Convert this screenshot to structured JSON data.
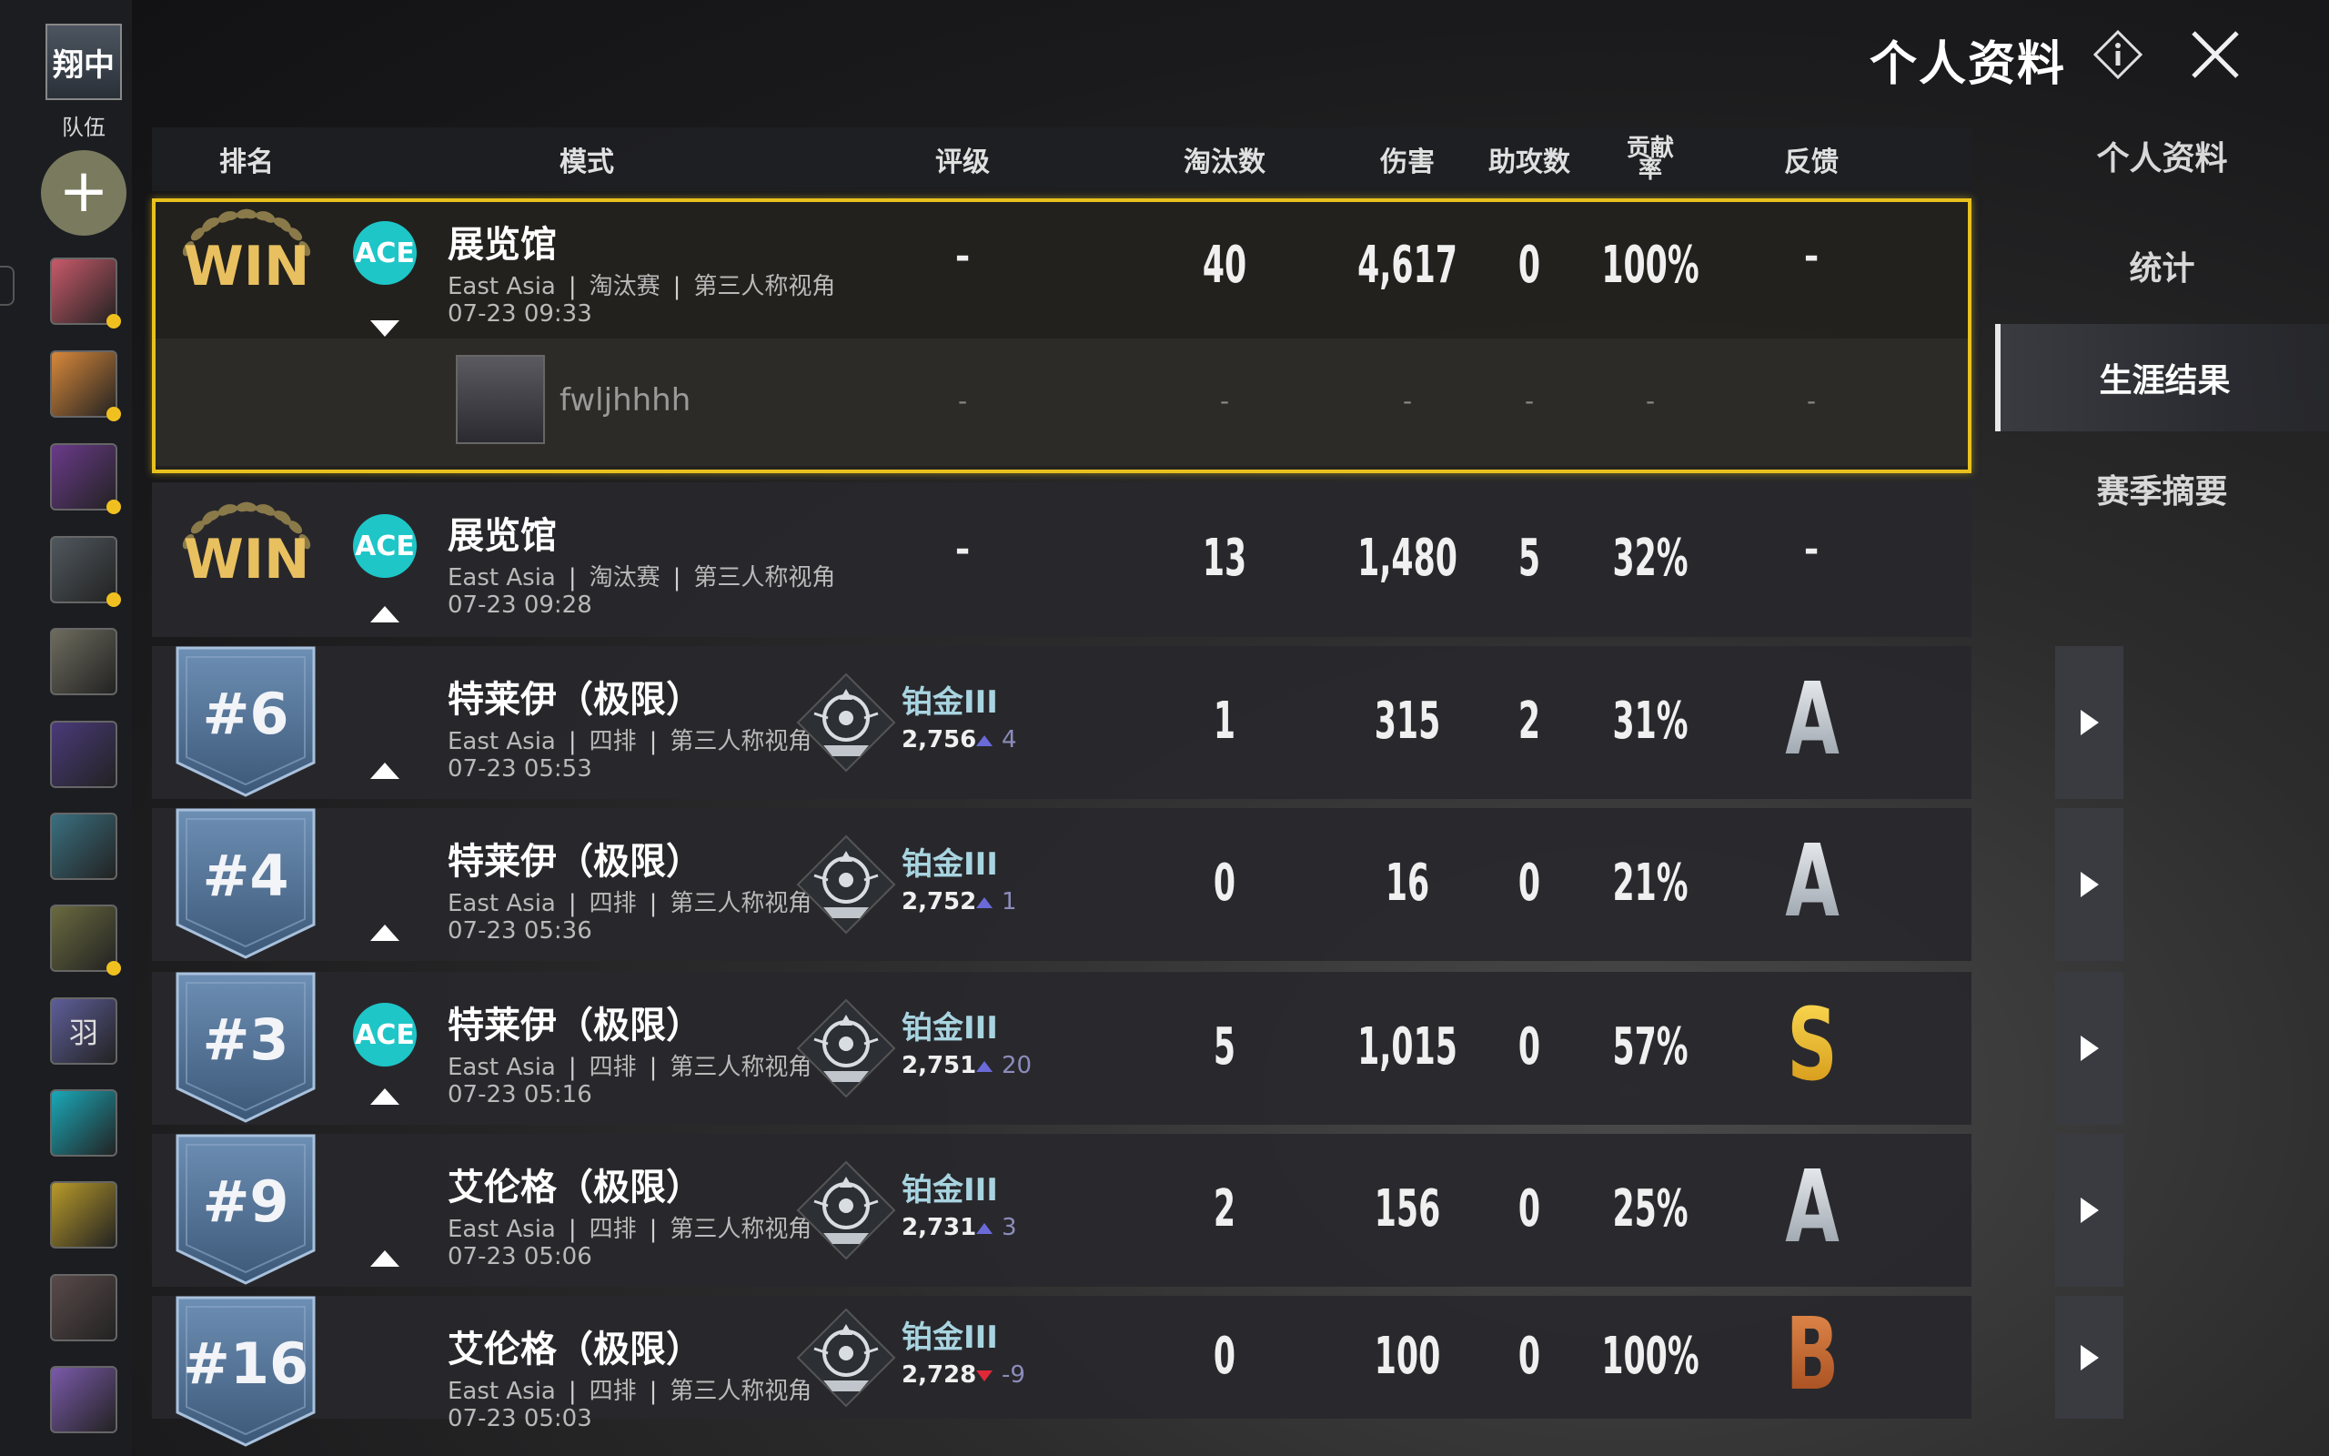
{
  "header": {
    "title": "个人资料"
  },
  "sidebar": {
    "team_icon_text": "翔中",
    "team_label": "队伍",
    "add_label": "+",
    "friends": [
      {
        "color": "#c85a6a",
        "status": true
      },
      {
        "color": "#d8883a",
        "status": true
      },
      {
        "color": "#6a3a8a",
        "status": true
      },
      {
        "color": "#50585e",
        "status": true
      },
      {
        "color": "#6e6c5e",
        "status": false
      },
      {
        "color": "#4a3a7a",
        "status": false
      },
      {
        "color": "#3a7080",
        "status": false
      },
      {
        "color": "#6a6a40",
        "status": true
      },
      {
        "color": "#5e5e9a",
        "status": false,
        "text": "羽"
      },
      {
        "color": "#1aa8b8",
        "status": false
      },
      {
        "color": "#b89a2a",
        "status": false
      },
      {
        "color": "#5a4a4a",
        "status": false
      },
      {
        "color": "#7a5aaa",
        "status": false
      }
    ]
  },
  "nav": {
    "items": [
      "个人资料",
      "统计",
      "生涯结果",
      "赛季摘要"
    ],
    "active": "生涯结果"
  },
  "table": {
    "headers": {
      "rank": "排名",
      "mode": "模式",
      "rating": "评级",
      "kills": "淘汰数",
      "damage": "伤害",
      "assists": "助攻数",
      "contribution": "贡献率",
      "feedback": "反馈"
    },
    "rows": [
      {
        "rank": "WIN",
        "ace": "ACE",
        "expanded": true,
        "map": "展览馆",
        "region": "East Asia",
        "mode": "淘汰赛",
        "view": "第三人称视角",
        "time": "07-23 09:33",
        "rating": "-",
        "kills": "40",
        "damage": "4,617",
        "assists": "0",
        "contribution": "100%",
        "feedback": "-",
        "teammate": {
          "name": "fwljhhhh",
          "values": [
            "-",
            "-",
            "-",
            "-",
            "-",
            "-"
          ]
        }
      },
      {
        "rank": "WIN",
        "ace": "ACE",
        "map": "展览馆",
        "region": "East Asia",
        "mode": "淘汰赛",
        "view": "第三人称视角",
        "time": "07-23 09:28",
        "rating": "-",
        "kills": "13",
        "damage": "1,480",
        "assists": "5",
        "contribution": "32%",
        "feedback": "-"
      },
      {
        "rank": "#6",
        "map": "特莱伊（极限）",
        "region": "East Asia",
        "mode": "四排",
        "view": "第三人称视角",
        "time": "07-23 05:53",
        "tier": "铂金III",
        "points": "2,756",
        "delta": "4",
        "delta_dir": "up",
        "kills": "1",
        "damage": "315",
        "assists": "2",
        "contribution": "31%",
        "grade": "A"
      },
      {
        "rank": "#4",
        "map": "特莱伊（极限）",
        "region": "East Asia",
        "mode": "四排",
        "view": "第三人称视角",
        "time": "07-23 05:36",
        "tier": "铂金III",
        "points": "2,752",
        "delta": "1",
        "delta_dir": "up",
        "kills": "0",
        "damage": "16",
        "assists": "0",
        "contribution": "21%",
        "grade": "A"
      },
      {
        "rank": "#3",
        "ace": "ACE",
        "map": "特莱伊（极限）",
        "region": "East Asia",
        "mode": "四排",
        "view": "第三人称视角",
        "time": "07-23 05:16",
        "tier": "铂金III",
        "points": "2,751",
        "delta": "20",
        "delta_dir": "up",
        "kills": "5",
        "damage": "1,015",
        "assists": "0",
        "contribution": "57%",
        "grade": "S"
      },
      {
        "rank": "#9",
        "map": "艾伦格（极限）",
        "region": "East Asia",
        "mode": "四排",
        "view": "第三人称视角",
        "time": "07-23 05:06",
        "tier": "铂金III",
        "points": "2,731",
        "delta": "3",
        "delta_dir": "up",
        "kills": "2",
        "damage": "156",
        "assists": "0",
        "contribution": "25%",
        "grade": "A"
      },
      {
        "rank": "#16",
        "map": "艾伦格（极限）",
        "region": "East Asia",
        "mode": "四排",
        "view": "第三人称视角",
        "time": "07-23 05:03",
        "tier": "铂金III",
        "points": "2,728",
        "delta": "-9",
        "delta_dir": "down",
        "kills": "0",
        "damage": "100",
        "assists": "0",
        "contribution": "100%",
        "grade": "B"
      }
    ]
  }
}
